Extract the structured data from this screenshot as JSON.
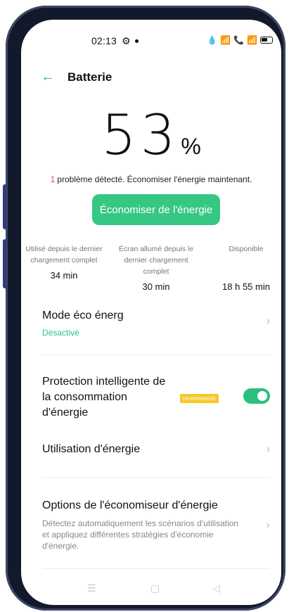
{
  "status": {
    "time": "02:13",
    "icons": [
      "settings-gear-icon",
      "notification-dot-icon",
      "drop-icon",
      "wifi-icon",
      "call-icon",
      "signal-icon",
      "battery-icon"
    ]
  },
  "header": {
    "title": "Batterie",
    "back_icon": "back-arrow-icon"
  },
  "battery": {
    "percent_number": "53",
    "percent_sign": "%",
    "problem_count": "1",
    "problem_text": "problème détecté. Économiser l'énergie maintenant.",
    "save_button": "Économiser de l'énergie"
  },
  "stats": [
    {
      "label": "Utilisé depuis le dernier chargement complet",
      "value": "34 min"
    },
    {
      "label": "Écran allumé depuis le dernier chargement complet",
      "value": "30 min"
    },
    {
      "label": "Disponible",
      "value": "18 h 55 min"
    }
  ],
  "settings": {
    "eco_mode": {
      "label": "Mode éco énerg",
      "status": "Désactivé"
    },
    "smart_protection": {
      "label": "Protection intelligente de la consommation d'énergie",
      "badge": "recommandé",
      "enabled": true
    },
    "usage": {
      "label": "Utilisation d'énergie"
    },
    "saver_options": {
      "label": "Options de l'économiseur d'énergie",
      "description": "Détectez automatiquement les scénarios d'utilisation et appliquez différentes stratégies d'économie d'énergie."
    }
  },
  "nav": {
    "icons": [
      "menu-icon",
      "home-icon",
      "back-icon"
    ]
  },
  "colors": {
    "accent": "#2dbf7e",
    "button": "#36c784",
    "badge": "#f7c724",
    "alert": "#e0494f"
  }
}
